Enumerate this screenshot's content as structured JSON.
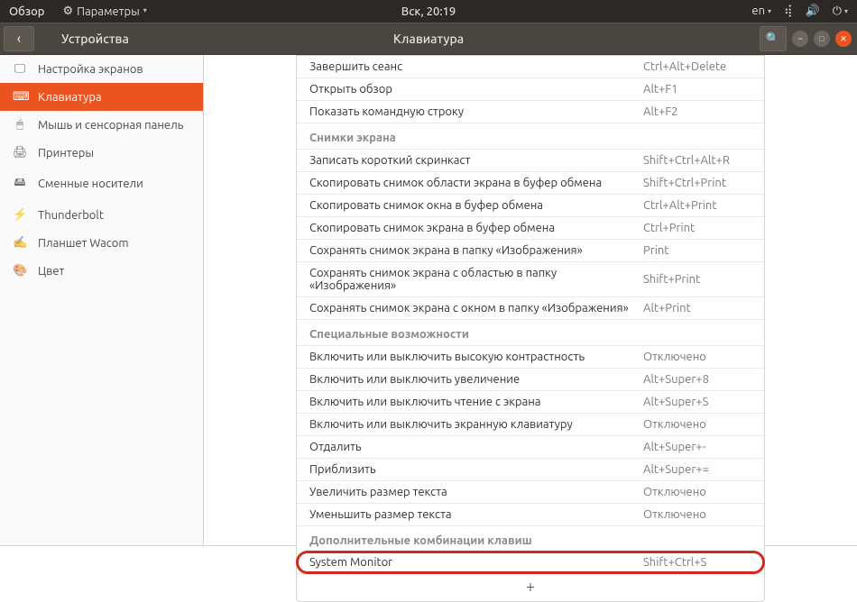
{
  "top_panel": {
    "activities": "Обзор",
    "app_menu": "Параметры",
    "clock": "Вск, 20:19",
    "lang": "en"
  },
  "header": {
    "left_title": "Устройства",
    "center_title": "Клавиатура"
  },
  "sidebar": {
    "items": [
      {
        "icon": "display",
        "label": "Настройка экранов"
      },
      {
        "icon": "keyboard",
        "label": "Клавиатура",
        "active": true
      },
      {
        "icon": "mouse",
        "label": "Мышь и сенсорная панель"
      },
      {
        "icon": "printer",
        "label": "Принтеры"
      },
      {
        "icon": "media",
        "label": "Сменные носители"
      },
      {
        "icon": "bolt",
        "label": "Thunderbolt"
      },
      {
        "icon": "tablet",
        "label": "Планшет Wacom"
      },
      {
        "icon": "color",
        "label": "Цвет"
      }
    ]
  },
  "sections": {
    "top_rows": [
      {
        "label": "Завершить сеанс",
        "shortcut": "Ctrl+Alt+Delete"
      },
      {
        "label": "Открыть обзор",
        "shortcut": "Alt+F1"
      },
      {
        "label": "Показать командную строку",
        "shortcut": "Alt+F2"
      }
    ],
    "screenshots_title": "Снимки экрана",
    "screenshots": [
      {
        "label": "Записать короткий скринкаст",
        "shortcut": "Shift+Ctrl+Alt+R"
      },
      {
        "label": "Скопировать снимок области экрана в буфер обмена",
        "shortcut": "Shift+Ctrl+Print"
      },
      {
        "label": "Скопировать снимок окна в буфер обмена",
        "shortcut": "Ctrl+Alt+Print"
      },
      {
        "label": "Скопировать снимок экрана в буфер обмена",
        "shortcut": "Ctrl+Print"
      },
      {
        "label": "Сохранять снимок экрана в папку «Изображения»",
        "shortcut": "Print"
      },
      {
        "label": "Сохранять снимок экрана с областью в папку «Изображения»",
        "shortcut": "Shift+Print"
      },
      {
        "label": "Сохранять снимок экрана с окном в папку «Изображения»",
        "shortcut": "Alt+Print"
      }
    ],
    "a11y_title": "Специальные возможности",
    "a11y": [
      {
        "label": "Включить или выключить высокую контрастность",
        "shortcut": "Отключено"
      },
      {
        "label": "Включить или выключить увеличение",
        "shortcut": "Alt+Super+8"
      },
      {
        "label": "Включить или выключить чтение с экрана",
        "shortcut": "Alt+Super+S"
      },
      {
        "label": "Включить или выключить экранную клавиатуру",
        "shortcut": "Отключено"
      },
      {
        "label": "Отдалить",
        "shortcut": "Alt+Super+-"
      },
      {
        "label": "Приблизить",
        "shortcut": "Alt+Super+="
      },
      {
        "label": "Увеличить размер текста",
        "shortcut": "Отключено"
      },
      {
        "label": "Уменьшить размер текста",
        "shortcut": "Отключено"
      }
    ],
    "custom_title": "Дополнительные комбинации клавиш",
    "custom": [
      {
        "label": "System Monitor",
        "shortcut": "Shift+Ctrl+S"
      }
    ],
    "add": "+"
  }
}
